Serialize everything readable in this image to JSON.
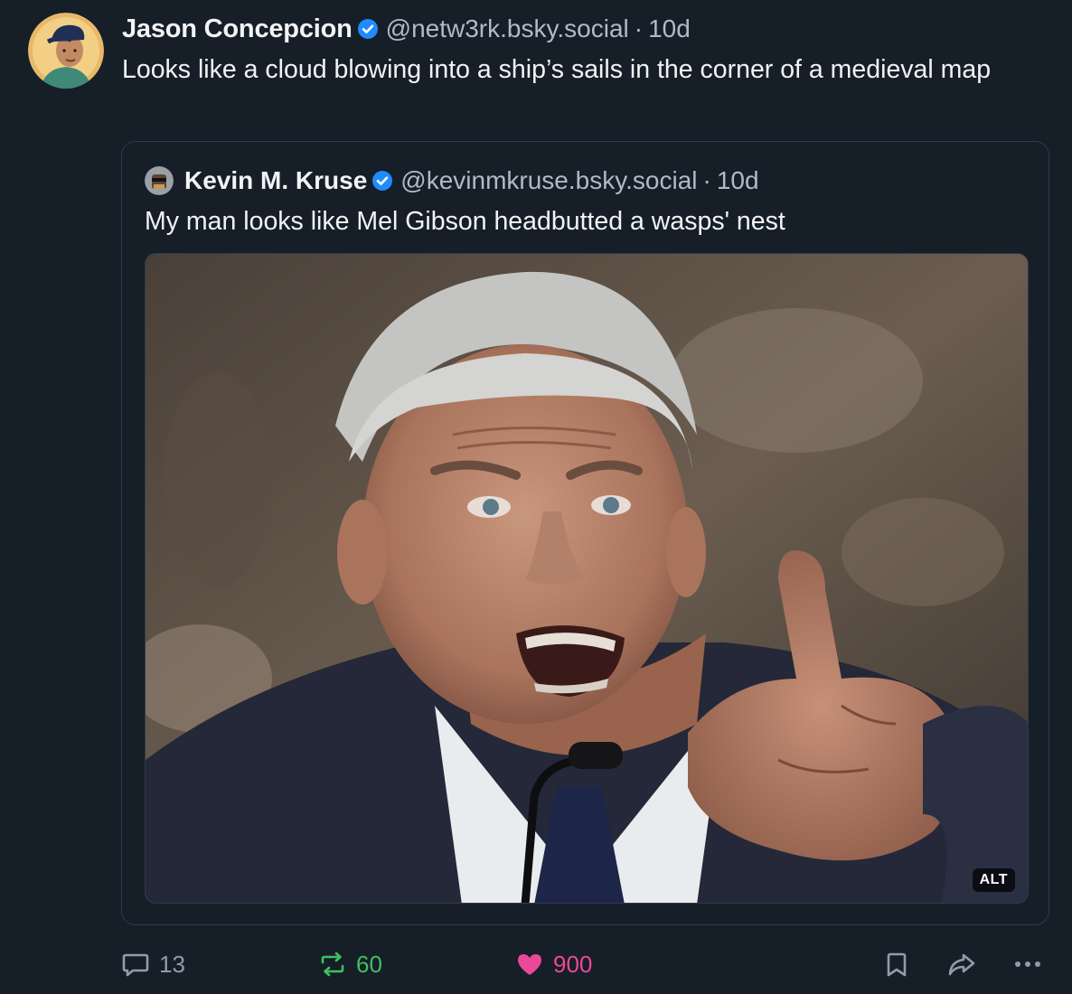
{
  "post": {
    "author": {
      "display_name": "Jason Concepcion",
      "handle": "@netw3rk.bsky.social",
      "verified": true
    },
    "separator": "·",
    "time": "10d",
    "text": "Looks like a cloud blowing into a ship’s sails in the corner of a medieval map",
    "quote": {
      "author": {
        "display_name": "Kevin M. Kruse",
        "handle": "@kevinmkruse.bsky.social",
        "verified": true
      },
      "separator": "·",
      "time": "10d",
      "text": "My man looks like Mel Gibson headbutted a wasps' nest",
      "image": {
        "alt_badge": "ALT"
      }
    },
    "actions": {
      "reply_count": "13",
      "repost_count": "60",
      "like_count": "900",
      "liked": true,
      "reposted": true
    }
  },
  "colors": {
    "background": "#161e27",
    "text_primary": "#f1f3f5",
    "text_secondary": "#aebbc9",
    "border": "#2e3c4c",
    "verified_blue": "#208bfe",
    "repost_green": "#3fbf62",
    "like_pink": "#ec4899"
  },
  "icons": {
    "verified": "verified-check-icon",
    "reply": "speech-bubble-icon",
    "repost": "repost-arrows-icon",
    "like": "heart-icon",
    "bookmark": "bookmark-icon",
    "share": "share-arrow-icon",
    "more": "more-dots-icon"
  }
}
